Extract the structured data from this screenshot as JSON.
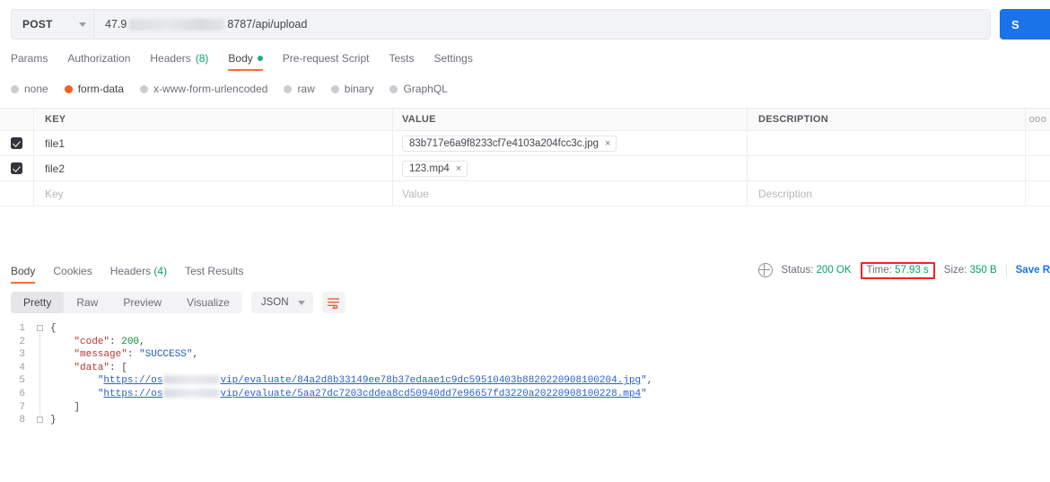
{
  "request": {
    "method": "POST",
    "url_prefix": "47.9",
    "url_suffix": "8787/api/upload",
    "send_label": "S",
    "tabs": [
      {
        "label": "Params",
        "active": false
      },
      {
        "label": "Authorization",
        "active": false
      },
      {
        "label": "Headers",
        "count": "(8)",
        "active": false
      },
      {
        "label": "Body",
        "active": true,
        "dot": true
      },
      {
        "label": "Pre-request Script",
        "active": false
      },
      {
        "label": "Tests",
        "active": false
      },
      {
        "label": "Settings",
        "active": false
      }
    ],
    "body_types": [
      {
        "label": "none",
        "selected": false
      },
      {
        "label": "form-data",
        "selected": true
      },
      {
        "label": "x-www-form-urlencoded",
        "selected": false
      },
      {
        "label": "raw",
        "selected": false
      },
      {
        "label": "binary",
        "selected": false
      },
      {
        "label": "GraphQL",
        "selected": false
      }
    ],
    "table": {
      "headers": {
        "key": "KEY",
        "value": "VALUE",
        "description": "DESCRIPTION",
        "more": "ooo"
      },
      "rows": [
        {
          "checked": true,
          "key": "file1",
          "file_chip": "83b717e6a9f8233cf7e4103a204fcc3c.jpg",
          "chip_close": "×",
          "description": ""
        },
        {
          "checked": true,
          "key": "file2",
          "file_chip": "123.mp4",
          "chip_close": "×",
          "description": ""
        }
      ],
      "placeholder_row": {
        "key": "Key",
        "value": "Value",
        "description": "Description"
      }
    }
  },
  "response": {
    "tabs": [
      {
        "label": "Body",
        "active": true
      },
      {
        "label": "Cookies",
        "active": false
      },
      {
        "label": "Headers",
        "count": "(4)",
        "active": false
      },
      {
        "label": "Test Results",
        "active": false
      }
    ],
    "meta": {
      "status_label": "Status:",
      "status_value": "200 OK",
      "time_label": "Time:",
      "time_value": "57.93 s",
      "size_label": "Size:",
      "size_value": "350 B",
      "save_label": "Save R",
      "highlight_color": "#f32222"
    },
    "toolbar": {
      "views": [
        {
          "label": "Pretty",
          "active": true
        },
        {
          "label": "Raw",
          "active": false
        },
        {
          "label": "Preview",
          "active": false
        },
        {
          "label": "Visualize",
          "active": false
        }
      ],
      "language": "JSON",
      "wrap_icon": "wrap-text-icon"
    },
    "code": {
      "line_numbers": [
        "1",
        "2",
        "3",
        "4",
        "5",
        "6",
        "7",
        "8"
      ],
      "lines": [
        {
          "n": "1",
          "indent": 0,
          "parts": [
            {
              "t": "punc",
              "v": "{"
            }
          ]
        },
        {
          "n": "2",
          "indent": 4,
          "parts": [
            {
              "t": "key",
              "v": "\"code\""
            },
            {
              "t": "punc",
              "v": ": "
            },
            {
              "t": "num",
              "v": "200"
            },
            {
              "t": "punc",
              "v": ","
            }
          ]
        },
        {
          "n": "3",
          "indent": 4,
          "parts": [
            {
              "t": "key",
              "v": "\"message\""
            },
            {
              "t": "punc",
              "v": ": "
            },
            {
              "t": "str",
              "v": "\"SUCCESS\""
            },
            {
              "t": "punc",
              "v": ","
            }
          ]
        },
        {
          "n": "4",
          "indent": 4,
          "parts": [
            {
              "t": "key",
              "v": "\"data\""
            },
            {
              "t": "punc",
              "v": ": "
            },
            {
              "t": "punc",
              "v": "["
            }
          ]
        },
        {
          "n": "5",
          "indent": 8,
          "parts": [
            {
              "t": "str",
              "v": "\""
            },
            {
              "t": "url",
              "v": "https://os"
            },
            {
              "t": "redact",
              "v": ""
            },
            {
              "t": "url",
              "v": "vip/evaluate/84a2d8b33149ee78b37edaae1c9dc59510403b8820220908100204.jpg"
            },
            {
              "t": "str",
              "v": "\""
            },
            {
              "t": "punc",
              "v": ","
            }
          ]
        },
        {
          "n": "6",
          "indent": 8,
          "parts": [
            {
              "t": "str",
              "v": "\""
            },
            {
              "t": "url",
              "v": "https://os"
            },
            {
              "t": "redact",
              "v": ""
            },
            {
              "t": "url",
              "v": "vip/evaluate/5aa27dc7203cddea8cd50940dd7e96657fd3220a20220908100228.mp4"
            },
            {
              "t": "str",
              "v": "\""
            }
          ]
        },
        {
          "n": "7",
          "indent": 4,
          "parts": [
            {
              "t": "punc",
              "v": "]"
            }
          ]
        },
        {
          "n": "8",
          "indent": 0,
          "parts": [
            {
              "t": "punc",
              "v": "}"
            }
          ]
        }
      ]
    }
  },
  "colors": {
    "accent": "#ff6c37",
    "link": "#1a73e8",
    "success": "#0aa06e",
    "highlight": "#f32222"
  }
}
